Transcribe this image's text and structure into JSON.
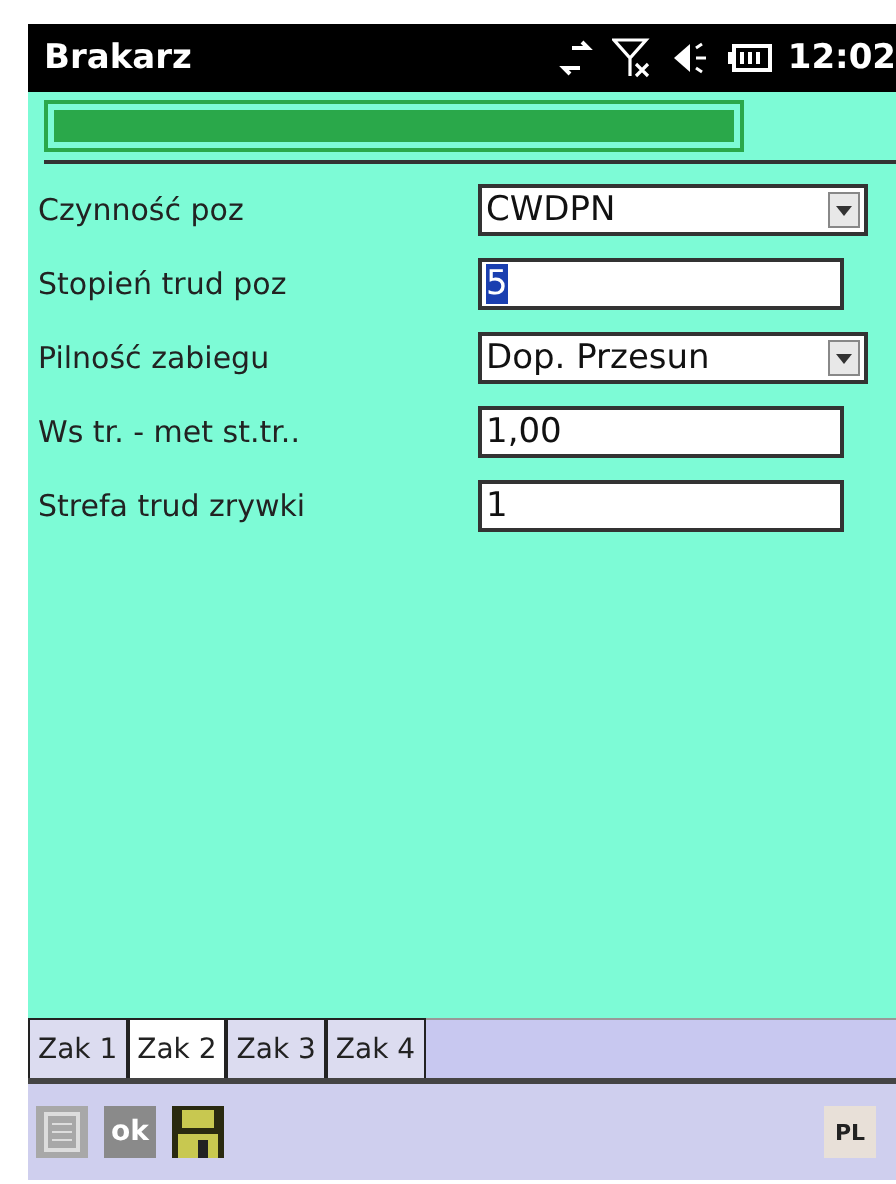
{
  "status_bar": {
    "title": "Brakarz",
    "time": "12:02"
  },
  "progress": {
    "level": 1
  },
  "fields": [
    {
      "label": "Czynność poz",
      "kind": "select",
      "value": "CWDPN",
      "highlighted": false
    },
    {
      "label": "Stopień trud poz",
      "kind": "text",
      "value": "5",
      "highlighted": true
    },
    {
      "label": "Pilność zabiegu",
      "kind": "select",
      "value": "Dop. Przesun",
      "highlighted": false
    },
    {
      "label": "Ws tr. - met st.tr..",
      "kind": "text",
      "value": "1,00",
      "highlighted": false
    },
    {
      "label": "Strefa trud zrywki",
      "kind": "text",
      "value": "1",
      "highlighted": false
    }
  ],
  "tabs": [
    {
      "label": "Zak 1",
      "selected": false
    },
    {
      "label": "Zak 2",
      "selected": true
    },
    {
      "label": "Zak 3",
      "selected": false
    },
    {
      "label": "Zak 4",
      "selected": false
    }
  ],
  "toolbar": {
    "ok": "ok",
    "language": "PL"
  }
}
